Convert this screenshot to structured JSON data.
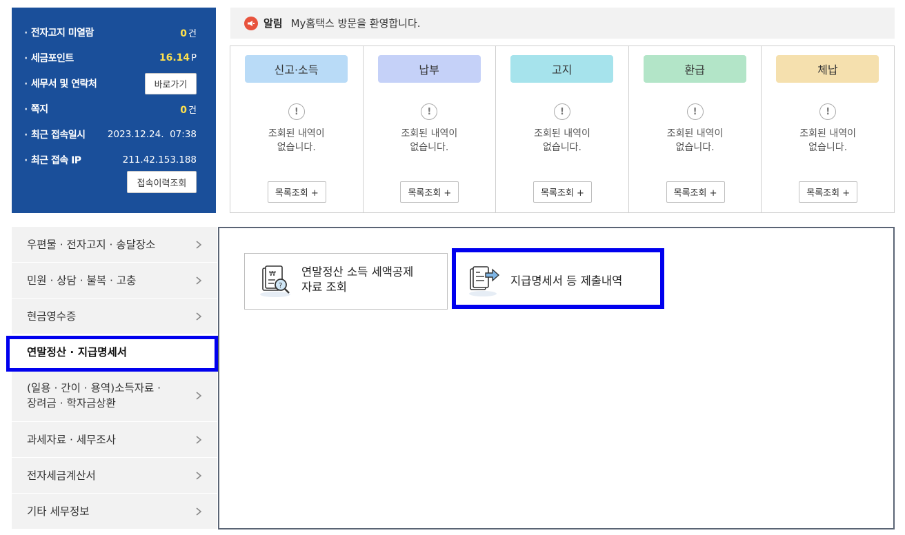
{
  "account": {
    "rows": [
      {
        "label": "전자고지 미열람",
        "value": "0",
        "unit": "건"
      },
      {
        "label": "세금포인트",
        "value": "16.14",
        "unit": "P"
      },
      {
        "label": "세무서 및 연락처"
      },
      {
        "label": "쪽지",
        "value": "0",
        "unit": "건"
      },
      {
        "label": "최근 접속일시",
        "text": "2023.12.24.  07:38"
      },
      {
        "label": "최근 접속 IP",
        "text": "211.42.153.188"
      }
    ],
    "go_button": "바로가기",
    "history_button": "접속이력조회"
  },
  "notice": {
    "tag": "알림",
    "message": "My홈택스 방문을 환영합니다.",
    "icon": "megaphone-icon"
  },
  "cards": [
    {
      "title": "신고·소득",
      "color": "#b9dbf7",
      "empty": [
        "조회된 내역이",
        "없습니다."
      ],
      "button": "목록조회 +"
    },
    {
      "title": "납부",
      "color": "#c5d1f8",
      "empty": [
        "조회된 내역이",
        "없습니다."
      ],
      "button": "목록조회 +"
    },
    {
      "title": "고지",
      "color": "#a6e3ec",
      "empty": [
        "조회된 내역이",
        "없습니다."
      ],
      "button": "목록조회 +"
    },
    {
      "title": "환급",
      "color": "#b3e5c8",
      "empty": [
        "조회된 내역이",
        "없습니다."
      ],
      "button": "목록조회 +"
    },
    {
      "title": "체납",
      "color": "#f5e0ae",
      "empty": [
        "조회된 내역이",
        "없습니다."
      ],
      "button": "목록조회 +"
    }
  ],
  "menu": [
    {
      "label": "우편물 · 전자고지 · 송달장소"
    },
    {
      "label": "민원 · 상담 · 불복 · 고충"
    },
    {
      "label": "현금영수증"
    },
    {
      "label": "연말정산 · 지급명세서",
      "active": true
    },
    {
      "label": "(일용 · 간이 · 용역)소득자료 ·\n장려금 · 학자금상환"
    },
    {
      "label": "과세자료 · 세무조사"
    },
    {
      "label": "전자세금계산서"
    },
    {
      "label": "기타 세무정보"
    }
  ],
  "tiles": [
    {
      "label": "연말정산 소득 세액공제\n자료 조회",
      "icon": "receipt-search-icon"
    },
    {
      "label": "지급명세서 등 제출내역",
      "icon": "document-submit-icon"
    }
  ],
  "colors": {
    "panel_blue": "#1a4f9a",
    "value_yellow": "#ffe14d",
    "highlight": "#0000ee",
    "notice_red": "#e8533d"
  }
}
